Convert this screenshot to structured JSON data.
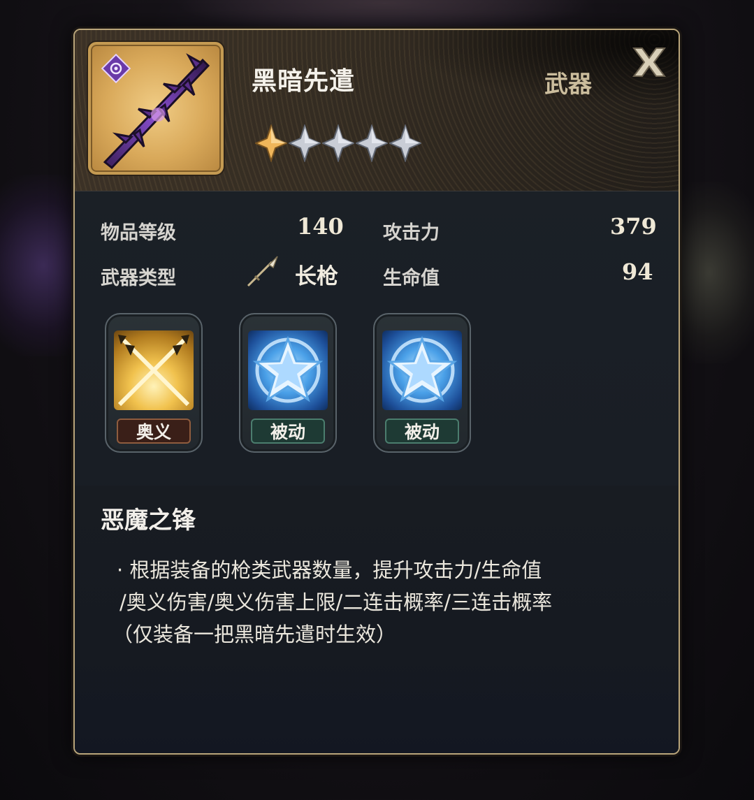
{
  "item": {
    "name": "黑暗先遣",
    "category": "武器",
    "stars_filled": 1,
    "stars_total": 5,
    "rarity_icon": "purple-diamond-icon"
  },
  "stats": {
    "item_level_label": "物品等级",
    "item_level_value": "140",
    "weapon_type_label": "武器类型",
    "weapon_type_value": "长枪",
    "attack_label": "攻击力",
    "attack_value": "379",
    "hp_label": "生命值",
    "hp_value": "94"
  },
  "skills": [
    {
      "tag": "奥义",
      "icon": "crossed-spears-icon"
    },
    {
      "tag": "被动",
      "icon": "blue-star-icon"
    },
    {
      "tag": "被动",
      "icon": "blue-star-icon"
    }
  ],
  "description": {
    "title": "恶魔之锋",
    "lines": [
      "· 根据装备的枪类武器数量，提升攻击力/生命值",
      "/奥义伤害/奥义伤害上限/二连击概率/三连击概率",
      "（仅装备一把黑暗先遣时生效）"
    ]
  },
  "colors": {
    "border_gold": "#b9a57a",
    "star_gold": "#f0b65a",
    "star_silver": "#c9cdd6",
    "tag_special": "#3a1f18",
    "tag_passive": "#1e3a34"
  }
}
